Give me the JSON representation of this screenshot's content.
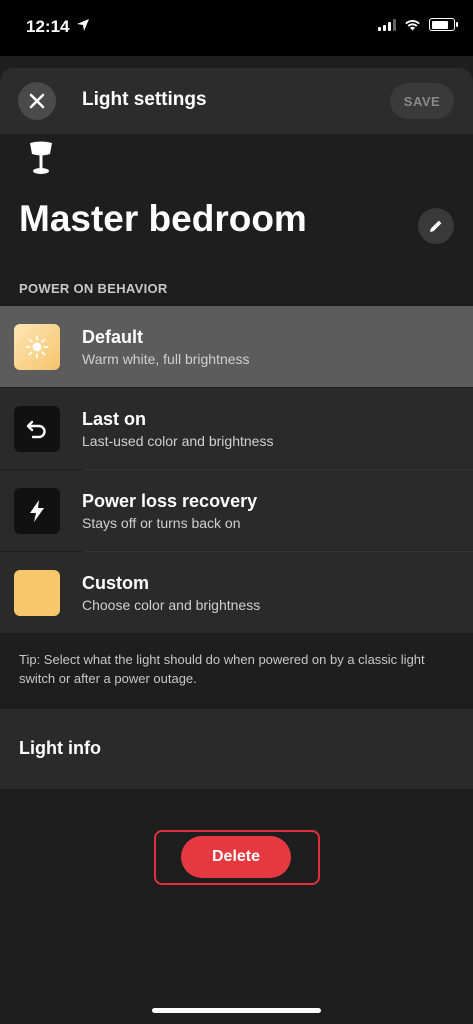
{
  "status": {
    "time": "12:14",
    "battery_level": 0.8
  },
  "header": {
    "title": "Light settings",
    "save_label": "SAVE"
  },
  "room": {
    "name": "Master bedroom",
    "icon": "table-lamp-icon"
  },
  "section": {
    "label": "POWER ON BEHAVIOR"
  },
  "options": [
    {
      "title": "Default",
      "subtitle": "Warm white, full brightness",
      "icon": "sun-icon",
      "selected": true,
      "color": "#fbd48a"
    },
    {
      "title": "Last on",
      "subtitle": "Last-used color and brightness",
      "icon": "undo-arrow-icon",
      "selected": false
    },
    {
      "title": "Power loss recovery",
      "subtitle": "Stays off or turns back on",
      "icon": "lightning-icon",
      "selected": false
    },
    {
      "title": "Custom",
      "subtitle": "Choose color and brightness",
      "icon": "color-swatch",
      "selected": false,
      "color": "#f8c76a"
    }
  ],
  "tip": "Tip: Select what the light should do when powered on by a classic light switch or after a power outage.",
  "info": {
    "label": "Light info"
  },
  "actions": {
    "delete_label": "Delete"
  },
  "colors": {
    "accent_delete": "#e6393f",
    "selected_row": "#5c5c5c",
    "background": "#1e1e1e"
  }
}
